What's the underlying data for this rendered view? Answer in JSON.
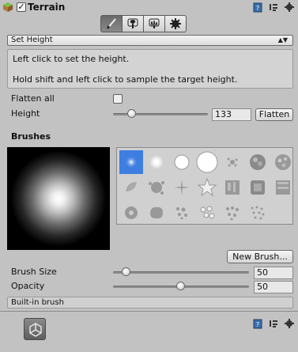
{
  "header": {
    "component_icon": "terrain-cube-icon",
    "enabled": true,
    "check_glyph": "✓",
    "title": "Terrain",
    "icons": [
      "help-book-icon",
      "preset-icon",
      "gear-icon"
    ]
  },
  "tools": [
    {
      "name": "paint-height-tool",
      "icon": "brush-icon",
      "active": true
    },
    {
      "name": "place-trees-tool",
      "icon": "tree-icon",
      "active": false
    },
    {
      "name": "paint-details-tool",
      "icon": "grass-icon",
      "active": false
    },
    {
      "name": "terrain-settings-tool",
      "icon": "gear-icon",
      "active": false
    }
  ],
  "mode_dropdown": {
    "value": "Set Height",
    "arrow": "▲▼"
  },
  "help": {
    "line1": "Left click to set the height.",
    "line2": "Hold shift and left click to sample the target height."
  },
  "flatten_all": {
    "label": "Flatten all",
    "checked": false
  },
  "height": {
    "label": "Height",
    "value": "133",
    "slider_fraction": 0.2,
    "button": "Flatten"
  },
  "brushes": {
    "title": "Brushes",
    "new_brush_button": "New Brush...",
    "selected_index": 0
  },
  "brush_size": {
    "label": "Brush Size",
    "value": "50",
    "slider_fraction": 0.1
  },
  "opacity": {
    "label": "Opacity",
    "value": "50",
    "slider_fraction": 0.5
  },
  "status": "Built-in brush",
  "bottom_component": {
    "icon": "unity-asset-icon",
    "header_icons": [
      "help-book-icon",
      "preset-icon",
      "gear-icon"
    ]
  },
  "colors": {
    "background": "#c2c2c2",
    "selection": "#3d7ee0"
  }
}
